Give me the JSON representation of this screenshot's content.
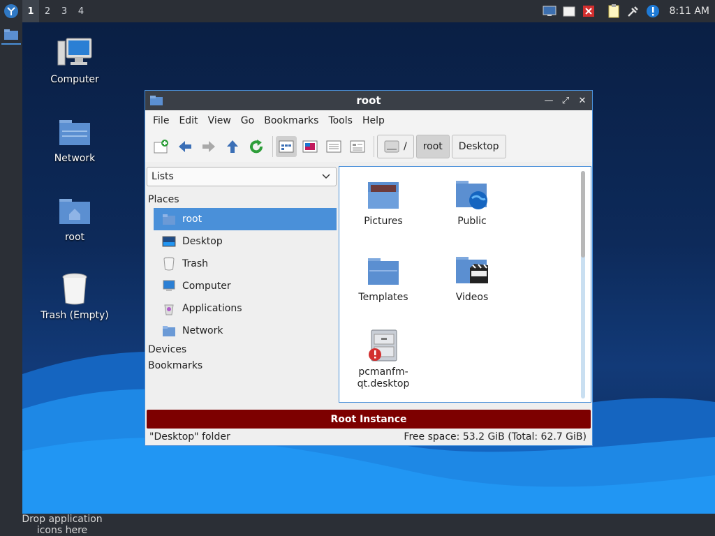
{
  "panel": {
    "workspaces": [
      "1",
      "2",
      "3",
      "4"
    ],
    "active_workspace": "1",
    "clock": "8:11 AM",
    "tray_icons": [
      "monitor-icon",
      "notes-icon",
      "close-app-icon",
      "clipboard-icon",
      "network-plug-icon",
      "alert-icon"
    ]
  },
  "desktop": {
    "icons": [
      {
        "label": "Computer",
        "icon": "computer-icon"
      },
      {
        "label": "Network",
        "icon": "network-folder-icon"
      },
      {
        "label": "root",
        "icon": "home-folder-icon"
      },
      {
        "label": "Trash (Empty)",
        "icon": "trash-icon"
      }
    ],
    "bottom_hint": "Drop application icons here"
  },
  "window": {
    "title": "root",
    "menu": [
      "File",
      "Edit",
      "View",
      "Go",
      "Bookmarks",
      "Tools",
      "Help"
    ],
    "breadcrumbs": [
      "/",
      "root",
      "Desktop"
    ],
    "side_pane": {
      "mode": "Lists",
      "groups": {
        "places": "Places",
        "devices": "Devices",
        "bookmarks": "Bookmarks"
      },
      "places": [
        "root",
        "Desktop",
        "Trash",
        "Computer",
        "Applications",
        "Network"
      ],
      "selected": "root"
    },
    "files": [
      {
        "name": "Pictures",
        "icon": "pictures-folder-icon"
      },
      {
        "name": "Public",
        "icon": "public-folder-icon"
      },
      {
        "name": "Templates",
        "icon": "templates-folder-icon"
      },
      {
        "name": "Videos",
        "icon": "videos-folder-icon"
      },
      {
        "name": "pcmanfm-qt.desktop",
        "line1": "pcmanfm-",
        "line2": "qt.desktop",
        "icon": "desktop-file-error-icon"
      }
    ],
    "banner": "Root Instance",
    "status": {
      "left": "\"Desktop\" folder",
      "right": "Free space: 53.2 GiB (Total: 62.7 GiB)"
    }
  },
  "colors": {
    "accent": "#4a90d9",
    "banner": "#7d0000",
    "panel": "#2b2f36"
  }
}
